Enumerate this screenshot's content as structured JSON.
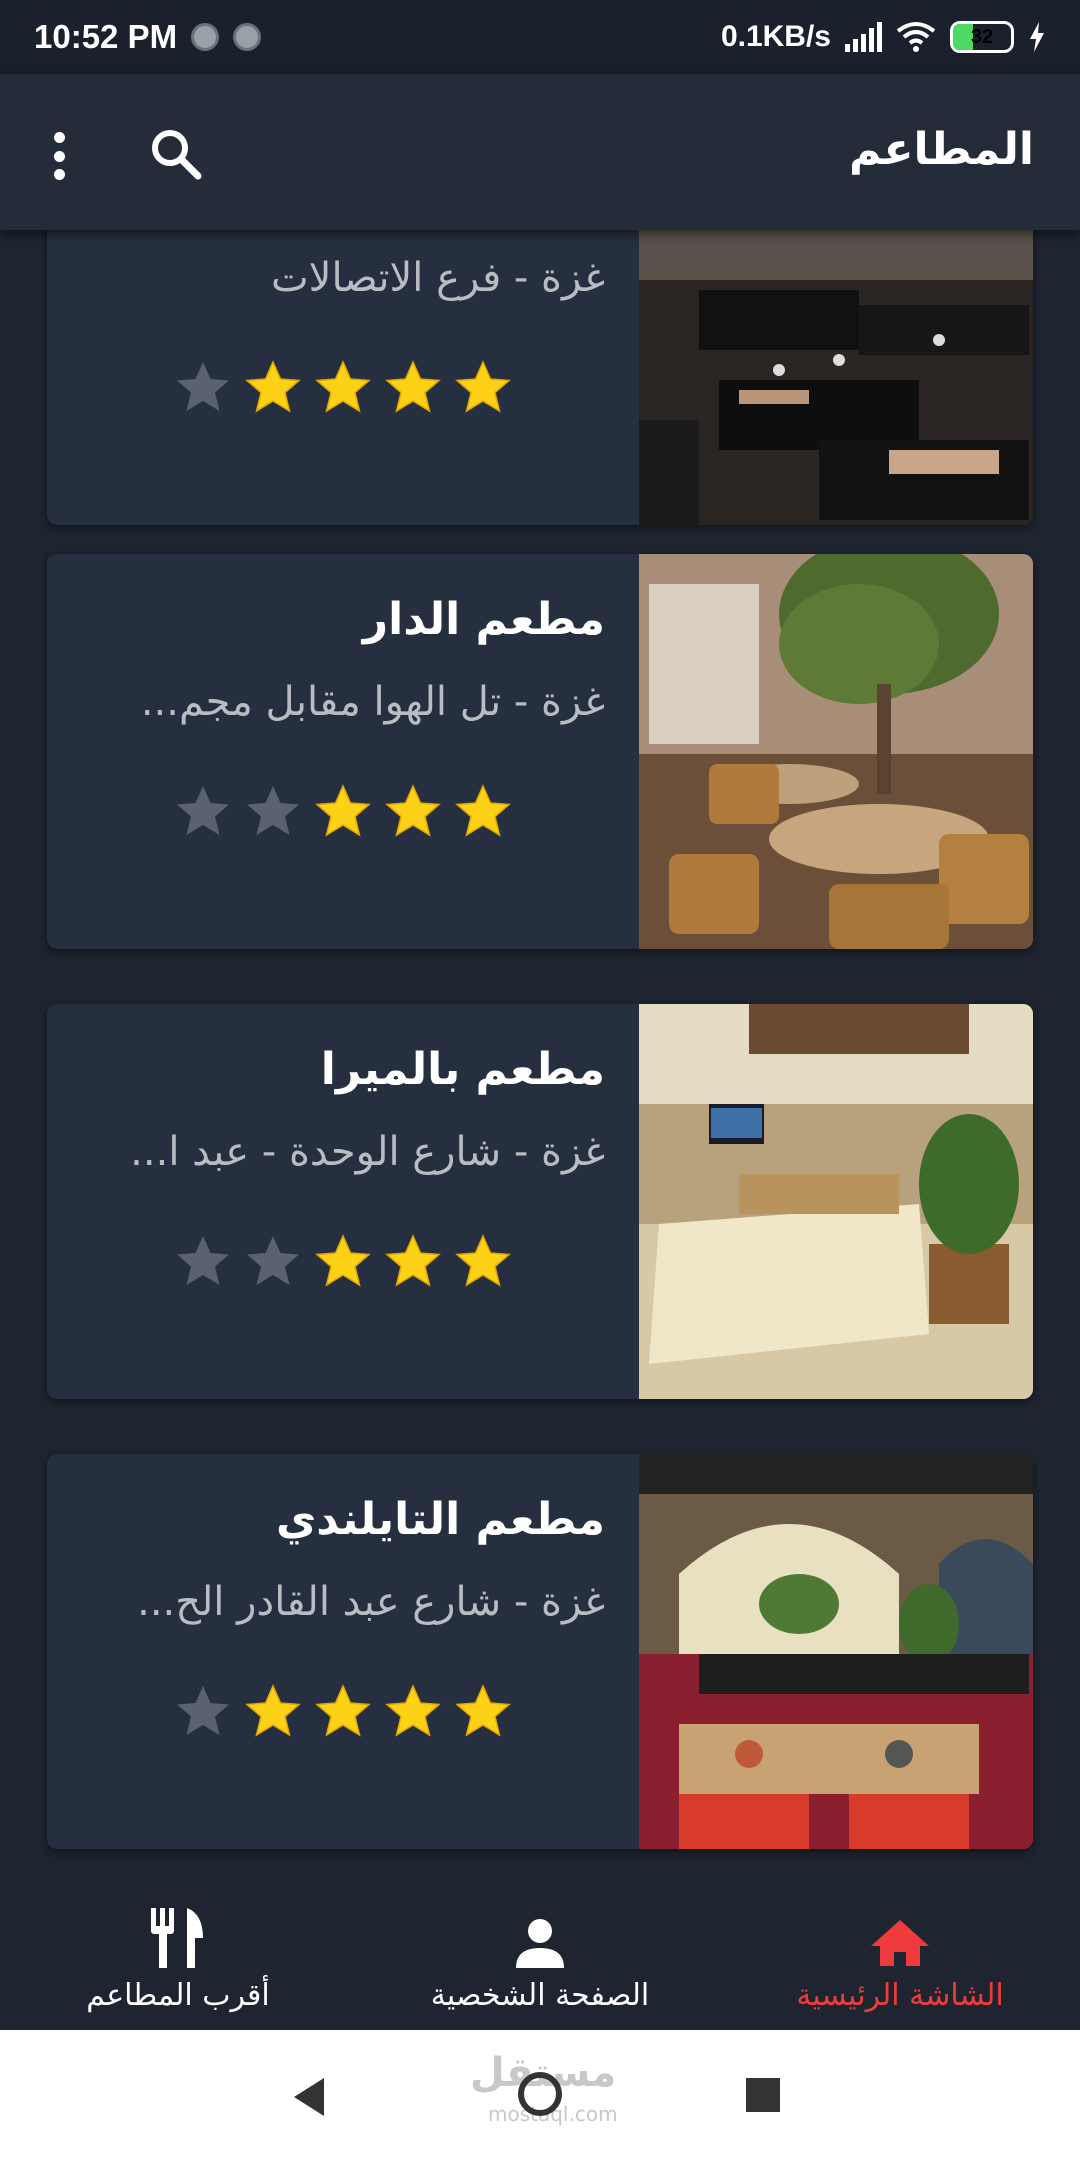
{
  "status_bar": {
    "time": "10:52 PM",
    "net_speed": "0.1KB/s",
    "battery": "32"
  },
  "app_bar": {
    "title": "المطاعم"
  },
  "restaurants": [
    {
      "name": "",
      "address": "غزة - فرع الاتصالات",
      "rating": 4,
      "max_rating": 5
    },
    {
      "name": "مطعم الدار",
      "address": "غزة - تل الهوا مقابل مجم...",
      "rating": 3,
      "max_rating": 5
    },
    {
      "name": "مطعم بالميرا",
      "address": "غزة - شارع الوحدة - عبد ا...",
      "rating": 3,
      "max_rating": 5
    },
    {
      "name": "مطعم التايلندي",
      "address": "غزة - شارع عبد القادر الح...",
      "rating": 4,
      "max_rating": 5
    }
  ],
  "bottom_nav": {
    "home_label": "الشاشة الرئيسية",
    "profile_label": "الصفحة الشخصية",
    "nearest_label": "أقرب المطاعم"
  },
  "watermark": {
    "text": "مستقل",
    "sub": "mostaql.com"
  },
  "colors": {
    "background": "#1e2430",
    "card": "#262f3f",
    "appbar": "#242c3a",
    "star_on": "#fcd116",
    "star_off": "#5a6270",
    "accent": "#ef3b3b"
  }
}
